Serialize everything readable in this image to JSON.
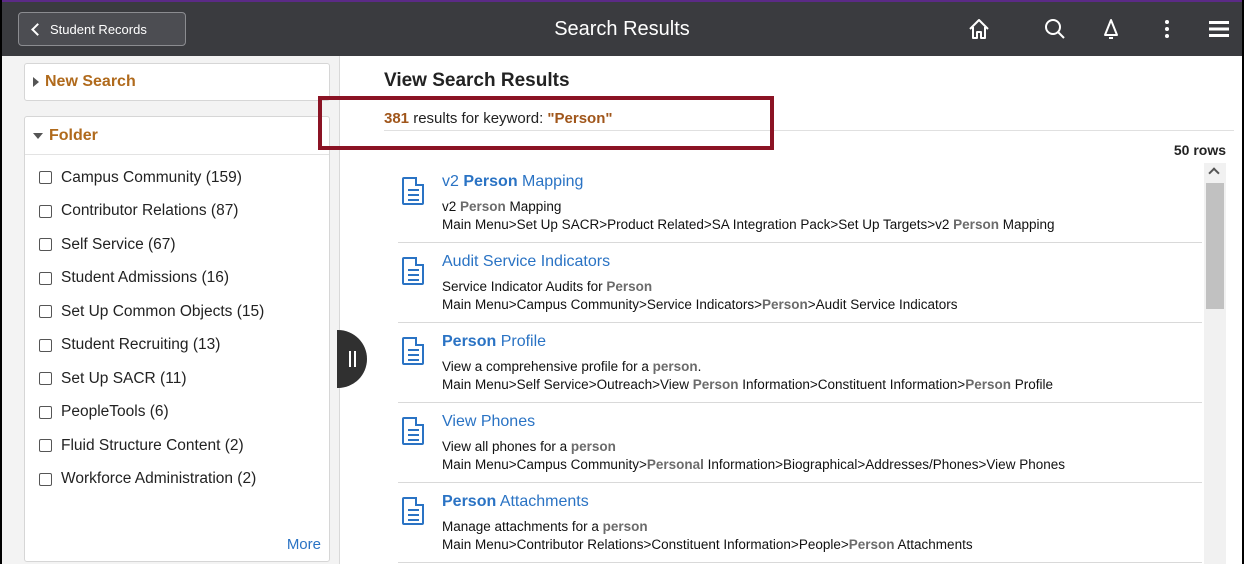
{
  "header": {
    "back_label": "Student Records",
    "title": "Search Results",
    "icons": [
      "home-icon",
      "search-icon",
      "bell-icon",
      "more-vertical-icon",
      "menu-icon"
    ],
    "background": "#3a3b3f"
  },
  "sidebar": {
    "new_search_label": "New Search",
    "folder_label": "Folder",
    "folders": [
      {
        "label": "Campus Community (159)"
      },
      {
        "label": "Contributor Relations (87)"
      },
      {
        "label": "Self Service (67)"
      },
      {
        "label": "Student Admissions (16)"
      },
      {
        "label": "Set Up Common Objects (15)"
      },
      {
        "label": "Student Recruiting (13)"
      },
      {
        "label": "Set Up SACR (11)"
      },
      {
        "label": "PeopleTools (6)"
      },
      {
        "label": "Fluid Structure Content (2)"
      },
      {
        "label": "Workforce Administration (2)"
      }
    ],
    "more_label": "More"
  },
  "main": {
    "title": "View Search Results",
    "result_count": "381",
    "results_text": " results for keyword: ",
    "keyword": "\"Person\"",
    "rows_label": "50 rows",
    "accent_color": "#a0561b",
    "link_color": "#2a73c4",
    "highlight_box_color": "#8b1324"
  },
  "results": [
    {
      "title_parts": [
        "v2 ",
        "Person",
        " Mapping"
      ],
      "desc_parts": [
        "v2 ",
        "Person",
        " Mapping"
      ],
      "path_parts": [
        "Main Menu>Set Up SACR>Product Related>SA Integration Pack>Set Up Targets>v2 ",
        "Person",
        " Mapping"
      ]
    },
    {
      "title_parts": [
        "Audit Service Indicators"
      ],
      "desc_parts": [
        "Service Indicator Audits for ",
        "Person"
      ],
      "path_parts": [
        "Main Menu>Campus Community>Service Indicators>",
        "Person",
        ">Audit Service Indicators"
      ]
    },
    {
      "title_parts": [
        "",
        "Person",
        " Profile"
      ],
      "desc_parts": [
        "View a comprehensive profile for a ",
        "person",
        "."
      ],
      "path_parts": [
        "Main Menu>Self Service>Outreach>View ",
        "Person",
        " Information>Constituent Information>",
        "Person",
        " Profile"
      ]
    },
    {
      "title_parts": [
        "View Phones"
      ],
      "desc_parts": [
        "View all phones for a ",
        "person"
      ],
      "path_parts": [
        "Main Menu>Campus Community>",
        "Personal",
        " Information>Biographical>Addresses/Phones>View Phones"
      ]
    },
    {
      "title_parts": [
        "",
        "Person",
        " Attachments"
      ],
      "desc_parts": [
        "Manage attachments for a ",
        "person"
      ],
      "path_parts": [
        "Main Menu>Contributor Relations>Constituent Information>People>",
        "Person",
        " Attachments"
      ]
    }
  ]
}
